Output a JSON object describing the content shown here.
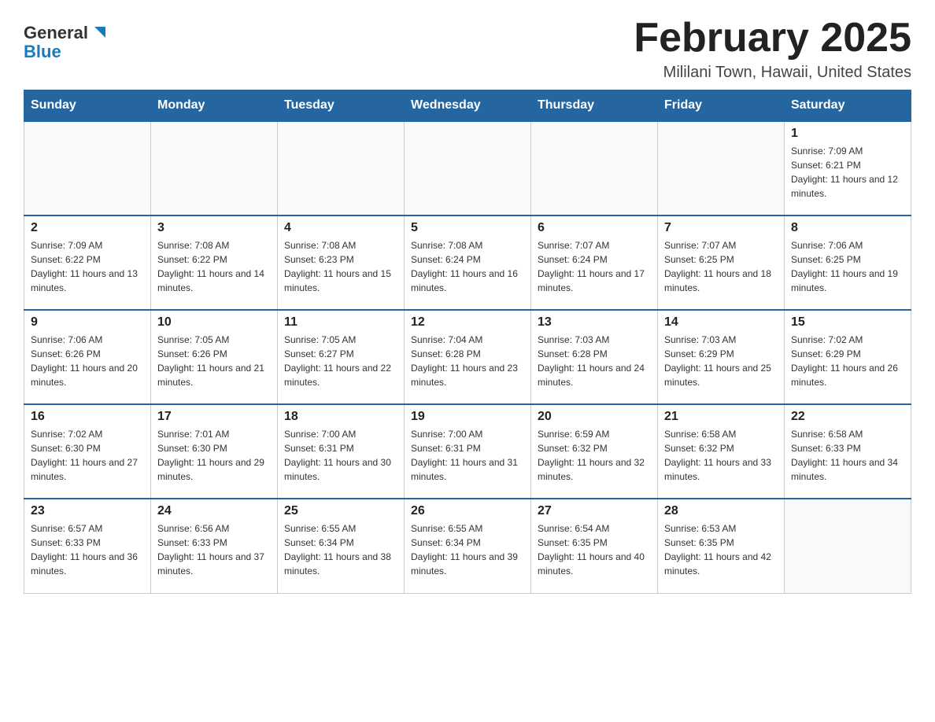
{
  "logo": {
    "general": "General",
    "blue": "Blue"
  },
  "title": "February 2025",
  "subtitle": "Mililani Town, Hawaii, United States",
  "weekdays": [
    "Sunday",
    "Monday",
    "Tuesday",
    "Wednesday",
    "Thursday",
    "Friday",
    "Saturday"
  ],
  "weeks": [
    [
      {
        "day": "",
        "info": ""
      },
      {
        "day": "",
        "info": ""
      },
      {
        "day": "",
        "info": ""
      },
      {
        "day": "",
        "info": ""
      },
      {
        "day": "",
        "info": ""
      },
      {
        "day": "",
        "info": ""
      },
      {
        "day": "1",
        "info": "Sunrise: 7:09 AM\nSunset: 6:21 PM\nDaylight: 11 hours and 12 minutes."
      }
    ],
    [
      {
        "day": "2",
        "info": "Sunrise: 7:09 AM\nSunset: 6:22 PM\nDaylight: 11 hours and 13 minutes."
      },
      {
        "day": "3",
        "info": "Sunrise: 7:08 AM\nSunset: 6:22 PM\nDaylight: 11 hours and 14 minutes."
      },
      {
        "day": "4",
        "info": "Sunrise: 7:08 AM\nSunset: 6:23 PM\nDaylight: 11 hours and 15 minutes."
      },
      {
        "day": "5",
        "info": "Sunrise: 7:08 AM\nSunset: 6:24 PM\nDaylight: 11 hours and 16 minutes."
      },
      {
        "day": "6",
        "info": "Sunrise: 7:07 AM\nSunset: 6:24 PM\nDaylight: 11 hours and 17 minutes."
      },
      {
        "day": "7",
        "info": "Sunrise: 7:07 AM\nSunset: 6:25 PM\nDaylight: 11 hours and 18 minutes."
      },
      {
        "day": "8",
        "info": "Sunrise: 7:06 AM\nSunset: 6:25 PM\nDaylight: 11 hours and 19 minutes."
      }
    ],
    [
      {
        "day": "9",
        "info": "Sunrise: 7:06 AM\nSunset: 6:26 PM\nDaylight: 11 hours and 20 minutes."
      },
      {
        "day": "10",
        "info": "Sunrise: 7:05 AM\nSunset: 6:26 PM\nDaylight: 11 hours and 21 minutes."
      },
      {
        "day": "11",
        "info": "Sunrise: 7:05 AM\nSunset: 6:27 PM\nDaylight: 11 hours and 22 minutes."
      },
      {
        "day": "12",
        "info": "Sunrise: 7:04 AM\nSunset: 6:28 PM\nDaylight: 11 hours and 23 minutes."
      },
      {
        "day": "13",
        "info": "Sunrise: 7:03 AM\nSunset: 6:28 PM\nDaylight: 11 hours and 24 minutes."
      },
      {
        "day": "14",
        "info": "Sunrise: 7:03 AM\nSunset: 6:29 PM\nDaylight: 11 hours and 25 minutes."
      },
      {
        "day": "15",
        "info": "Sunrise: 7:02 AM\nSunset: 6:29 PM\nDaylight: 11 hours and 26 minutes."
      }
    ],
    [
      {
        "day": "16",
        "info": "Sunrise: 7:02 AM\nSunset: 6:30 PM\nDaylight: 11 hours and 27 minutes."
      },
      {
        "day": "17",
        "info": "Sunrise: 7:01 AM\nSunset: 6:30 PM\nDaylight: 11 hours and 29 minutes."
      },
      {
        "day": "18",
        "info": "Sunrise: 7:00 AM\nSunset: 6:31 PM\nDaylight: 11 hours and 30 minutes."
      },
      {
        "day": "19",
        "info": "Sunrise: 7:00 AM\nSunset: 6:31 PM\nDaylight: 11 hours and 31 minutes."
      },
      {
        "day": "20",
        "info": "Sunrise: 6:59 AM\nSunset: 6:32 PM\nDaylight: 11 hours and 32 minutes."
      },
      {
        "day": "21",
        "info": "Sunrise: 6:58 AM\nSunset: 6:32 PM\nDaylight: 11 hours and 33 minutes."
      },
      {
        "day": "22",
        "info": "Sunrise: 6:58 AM\nSunset: 6:33 PM\nDaylight: 11 hours and 34 minutes."
      }
    ],
    [
      {
        "day": "23",
        "info": "Sunrise: 6:57 AM\nSunset: 6:33 PM\nDaylight: 11 hours and 36 minutes."
      },
      {
        "day": "24",
        "info": "Sunrise: 6:56 AM\nSunset: 6:33 PM\nDaylight: 11 hours and 37 minutes."
      },
      {
        "day": "25",
        "info": "Sunrise: 6:55 AM\nSunset: 6:34 PM\nDaylight: 11 hours and 38 minutes."
      },
      {
        "day": "26",
        "info": "Sunrise: 6:55 AM\nSunset: 6:34 PM\nDaylight: 11 hours and 39 minutes."
      },
      {
        "day": "27",
        "info": "Sunrise: 6:54 AM\nSunset: 6:35 PM\nDaylight: 11 hours and 40 minutes."
      },
      {
        "day": "28",
        "info": "Sunrise: 6:53 AM\nSunset: 6:35 PM\nDaylight: 11 hours and 42 minutes."
      },
      {
        "day": "",
        "info": ""
      }
    ]
  ]
}
